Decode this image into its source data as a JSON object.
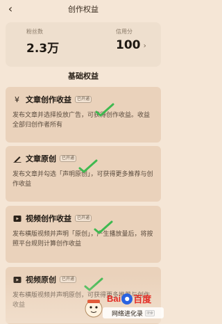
{
  "header": {
    "title": "创作权益"
  },
  "stats": {
    "fans_label": "粉丝数",
    "fans_value": "2.3万",
    "credit_label": "信用分",
    "credit_value": "100"
  },
  "section": {
    "title": "基础权益"
  },
  "cards": [
    {
      "name": "文章创作收益",
      "tag": "已开通",
      "desc": "发布文章并选择投放广告，可获得创作收益。收益全部归创作者所有",
      "icon": "yuan-icon"
    },
    {
      "name": "文章原创",
      "tag": "已开通",
      "desc": "发布文章并勾选「声明原创」，可获得更多推荐与创作收益",
      "icon": "pen-icon"
    },
    {
      "name": "视频创作收益",
      "tag": "已开通",
      "desc": "发布横版视频并声明「原创」，产生播放量后，将按照平台规则计算创作收益",
      "icon": "video-icon"
    },
    {
      "name": "视频原创",
      "tag": "已开通",
      "desc": "发布横版视频并声明原创，可获得更多推荐与创作收益",
      "icon": "video-icon"
    }
  ],
  "watermark": {
    "brand_left": "Bai",
    "brand_right": "百度",
    "sub": "网络进化录",
    "search": "搜索"
  },
  "colors": {
    "check": "#3fb950",
    "background": "#f5e6d6",
    "card": "#ead2bb"
  }
}
